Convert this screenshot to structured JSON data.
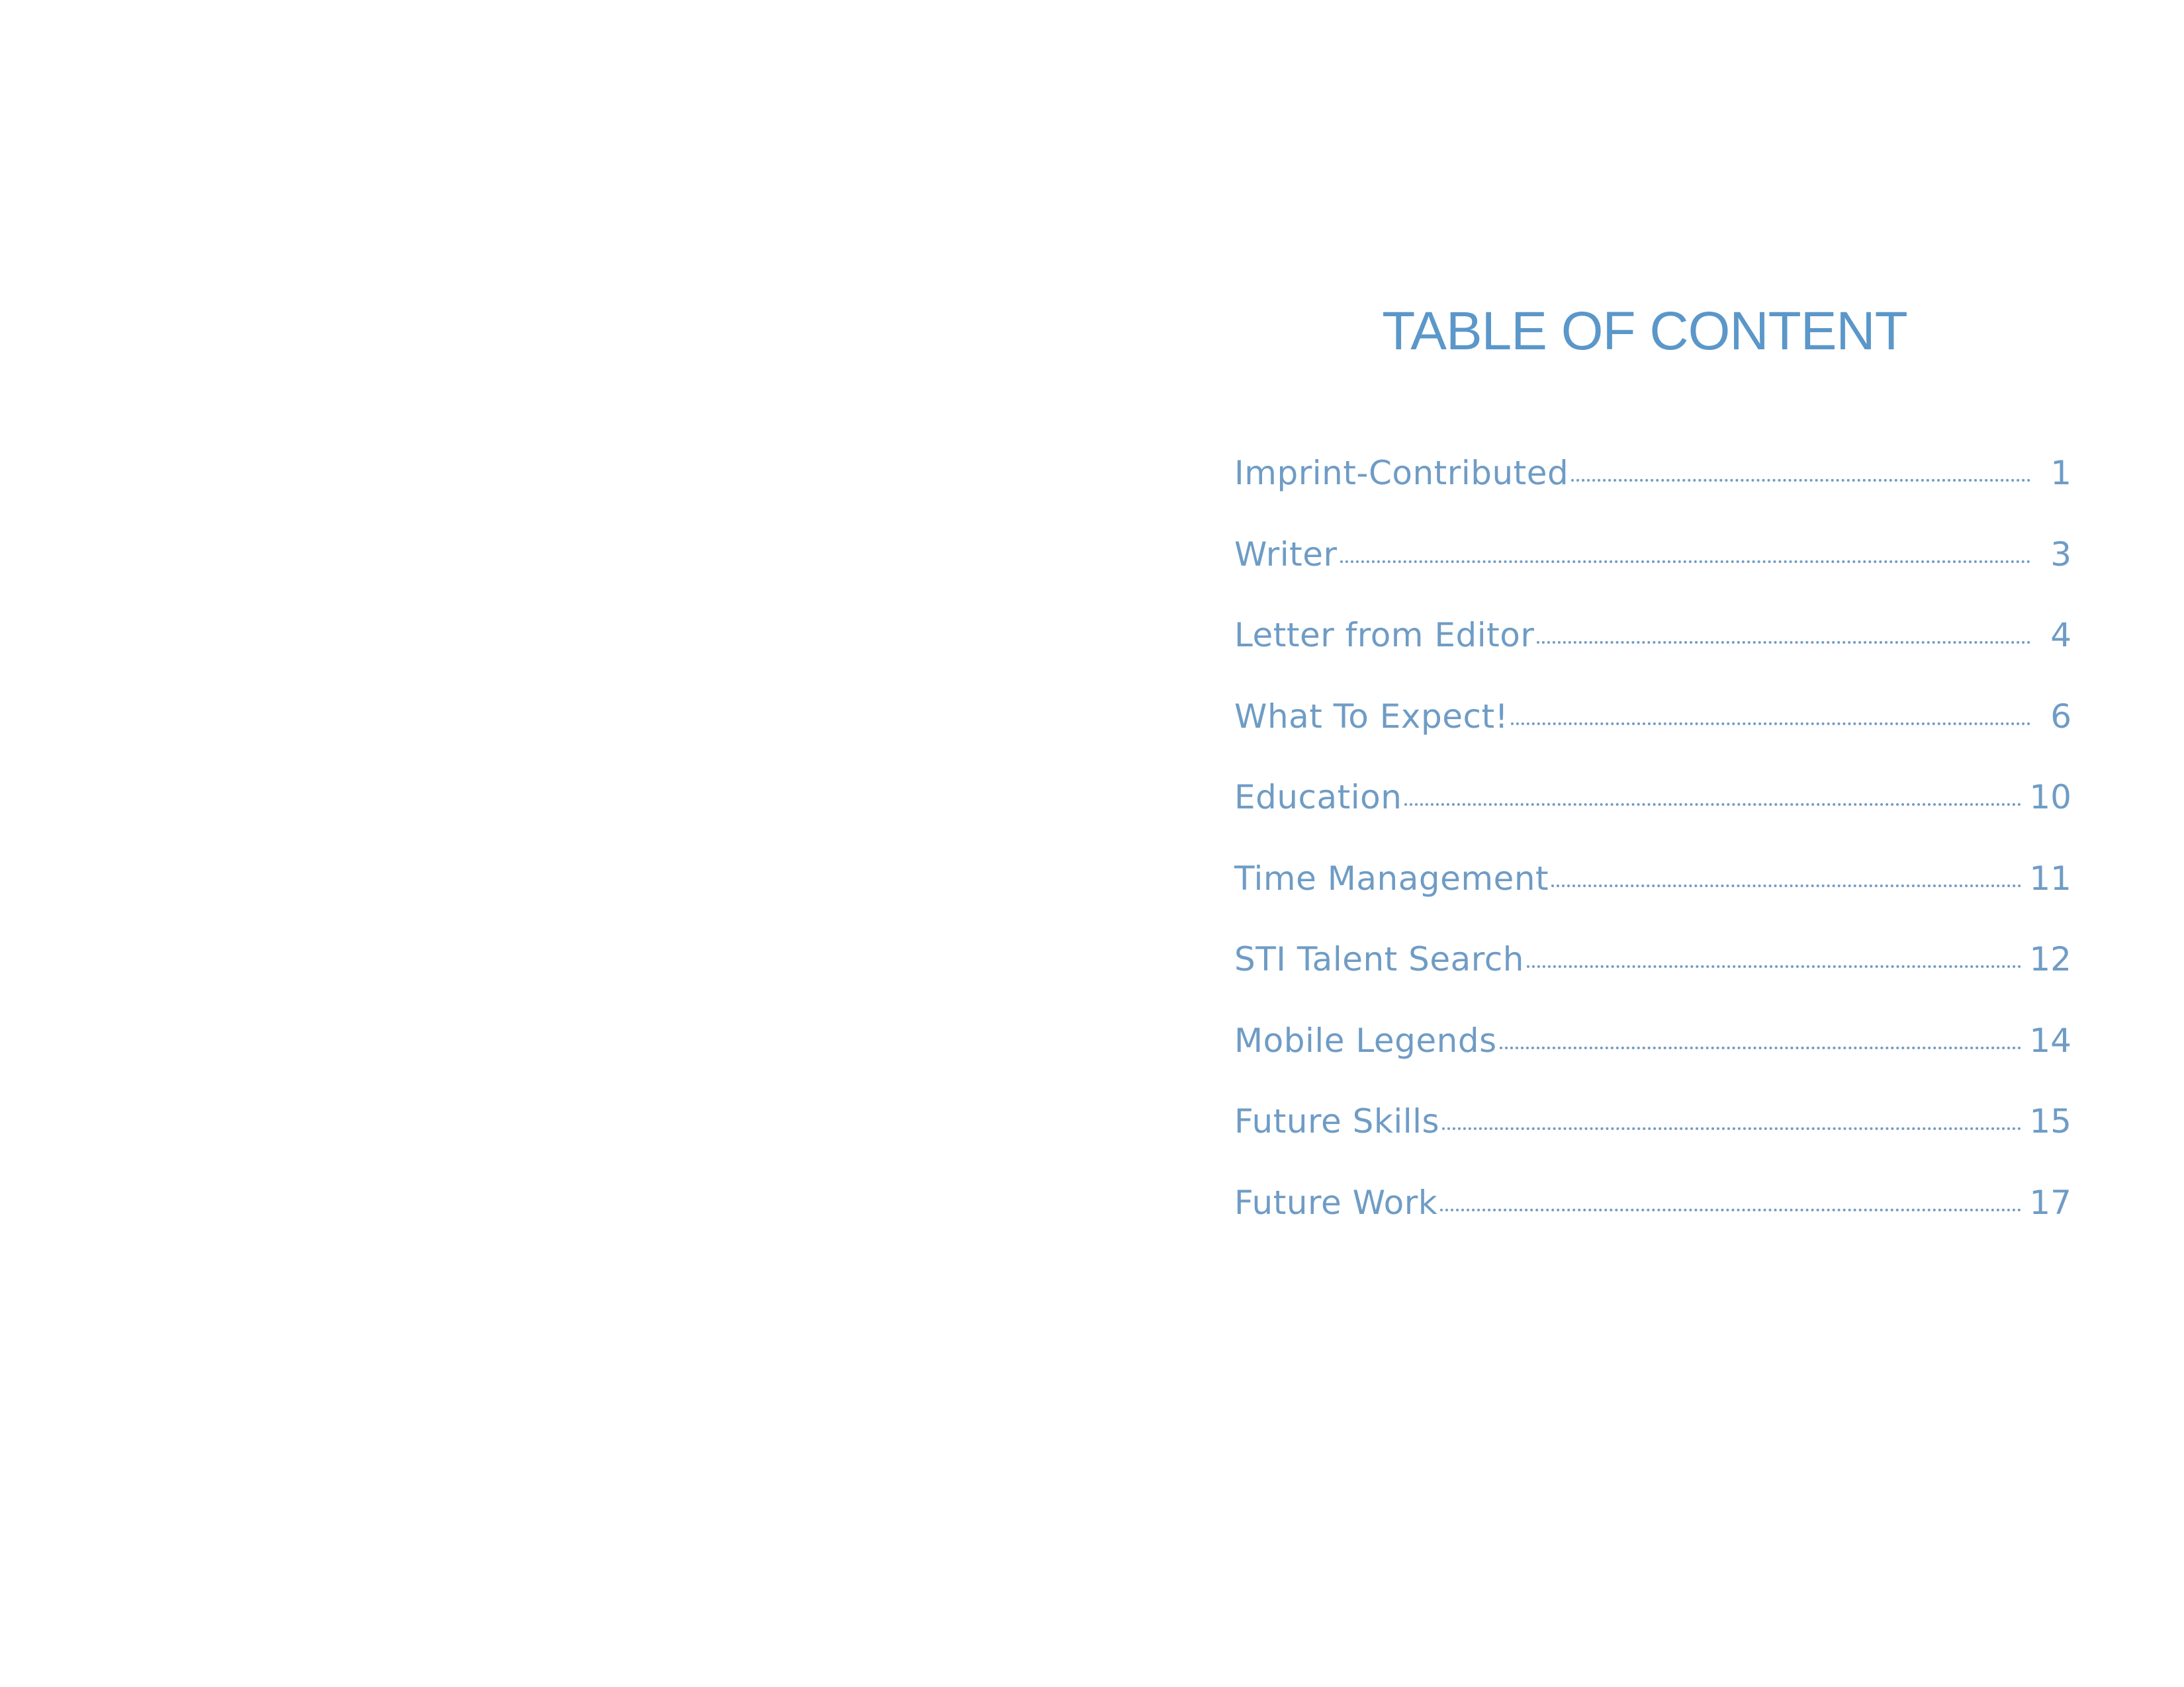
{
  "title": "TABLE OF CONTENT",
  "entries": [
    {
      "label": "Imprint-Contributed",
      "page": "1"
    },
    {
      "label": "Writer",
      "page": "3"
    },
    {
      "label": "Letter from Editor",
      "page": "4"
    },
    {
      "label": "What To Expect!",
      "page": "6"
    },
    {
      "label": "Education",
      "page": "10"
    },
    {
      "label": "Time Management",
      "page": "11"
    },
    {
      "label": "STI Talent Search",
      "page": "12"
    },
    {
      "label": "Mobile Legends",
      "page": "14"
    },
    {
      "label": "Future Skills",
      "page": "15"
    },
    {
      "label": "Future Work",
      "page": "17"
    }
  ],
  "colors": {
    "title": "#5b97c9",
    "entries": "#6f9cc5",
    "background": "#ffffff"
  }
}
